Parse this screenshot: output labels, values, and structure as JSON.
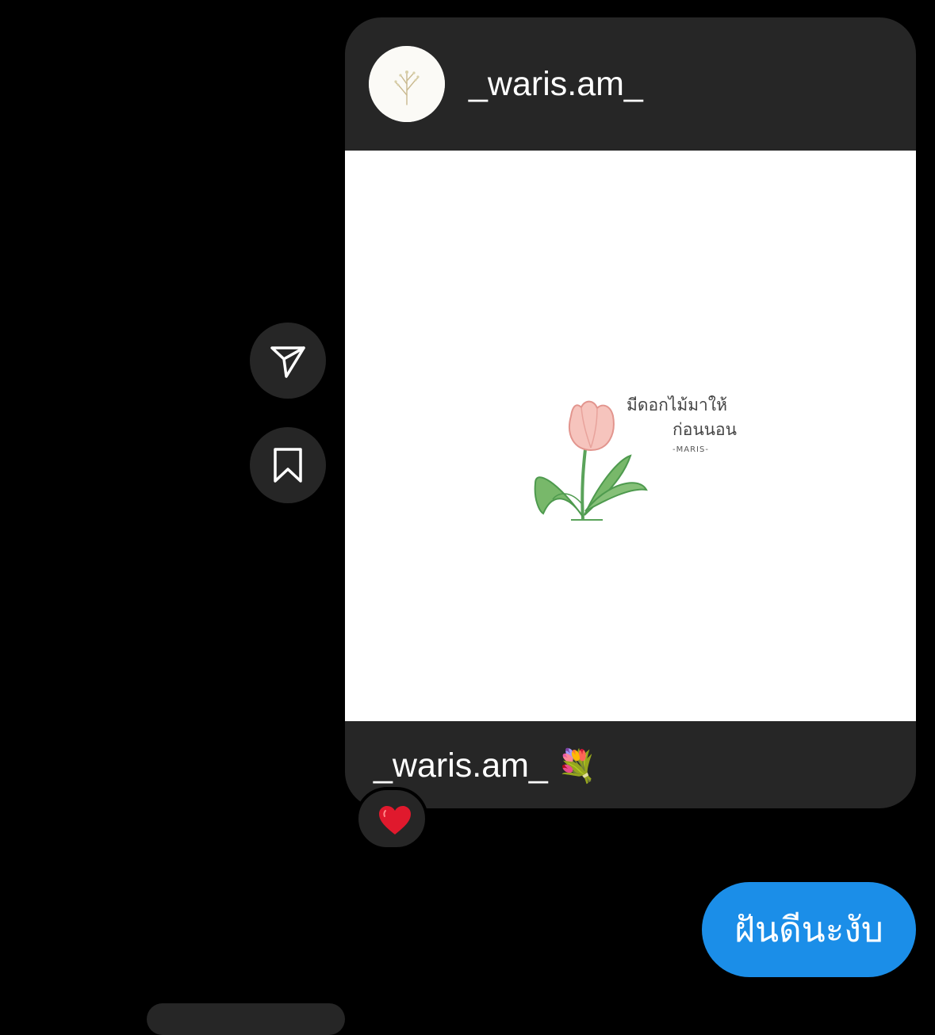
{
  "post": {
    "username": "_waris.am_",
    "image_text_line1": "มีดอกไม้มาให้",
    "image_text_line2": "ก่อนนอน",
    "image_signature": "-MARIS-",
    "caption_username": "_waris.am_",
    "caption_emoji": "💐"
  },
  "reaction": {
    "emoji": "❤️",
    "icon": "heart-icon"
  },
  "actions": {
    "share_icon": "paper-plane-icon",
    "save_icon": "bookmark-icon"
  },
  "sent_message": {
    "text": "ฝันดีนะงับ"
  },
  "colors": {
    "background": "#000000",
    "card": "#262626",
    "sent_bubble": "#1b8ee8",
    "heart": "#e0192d"
  }
}
